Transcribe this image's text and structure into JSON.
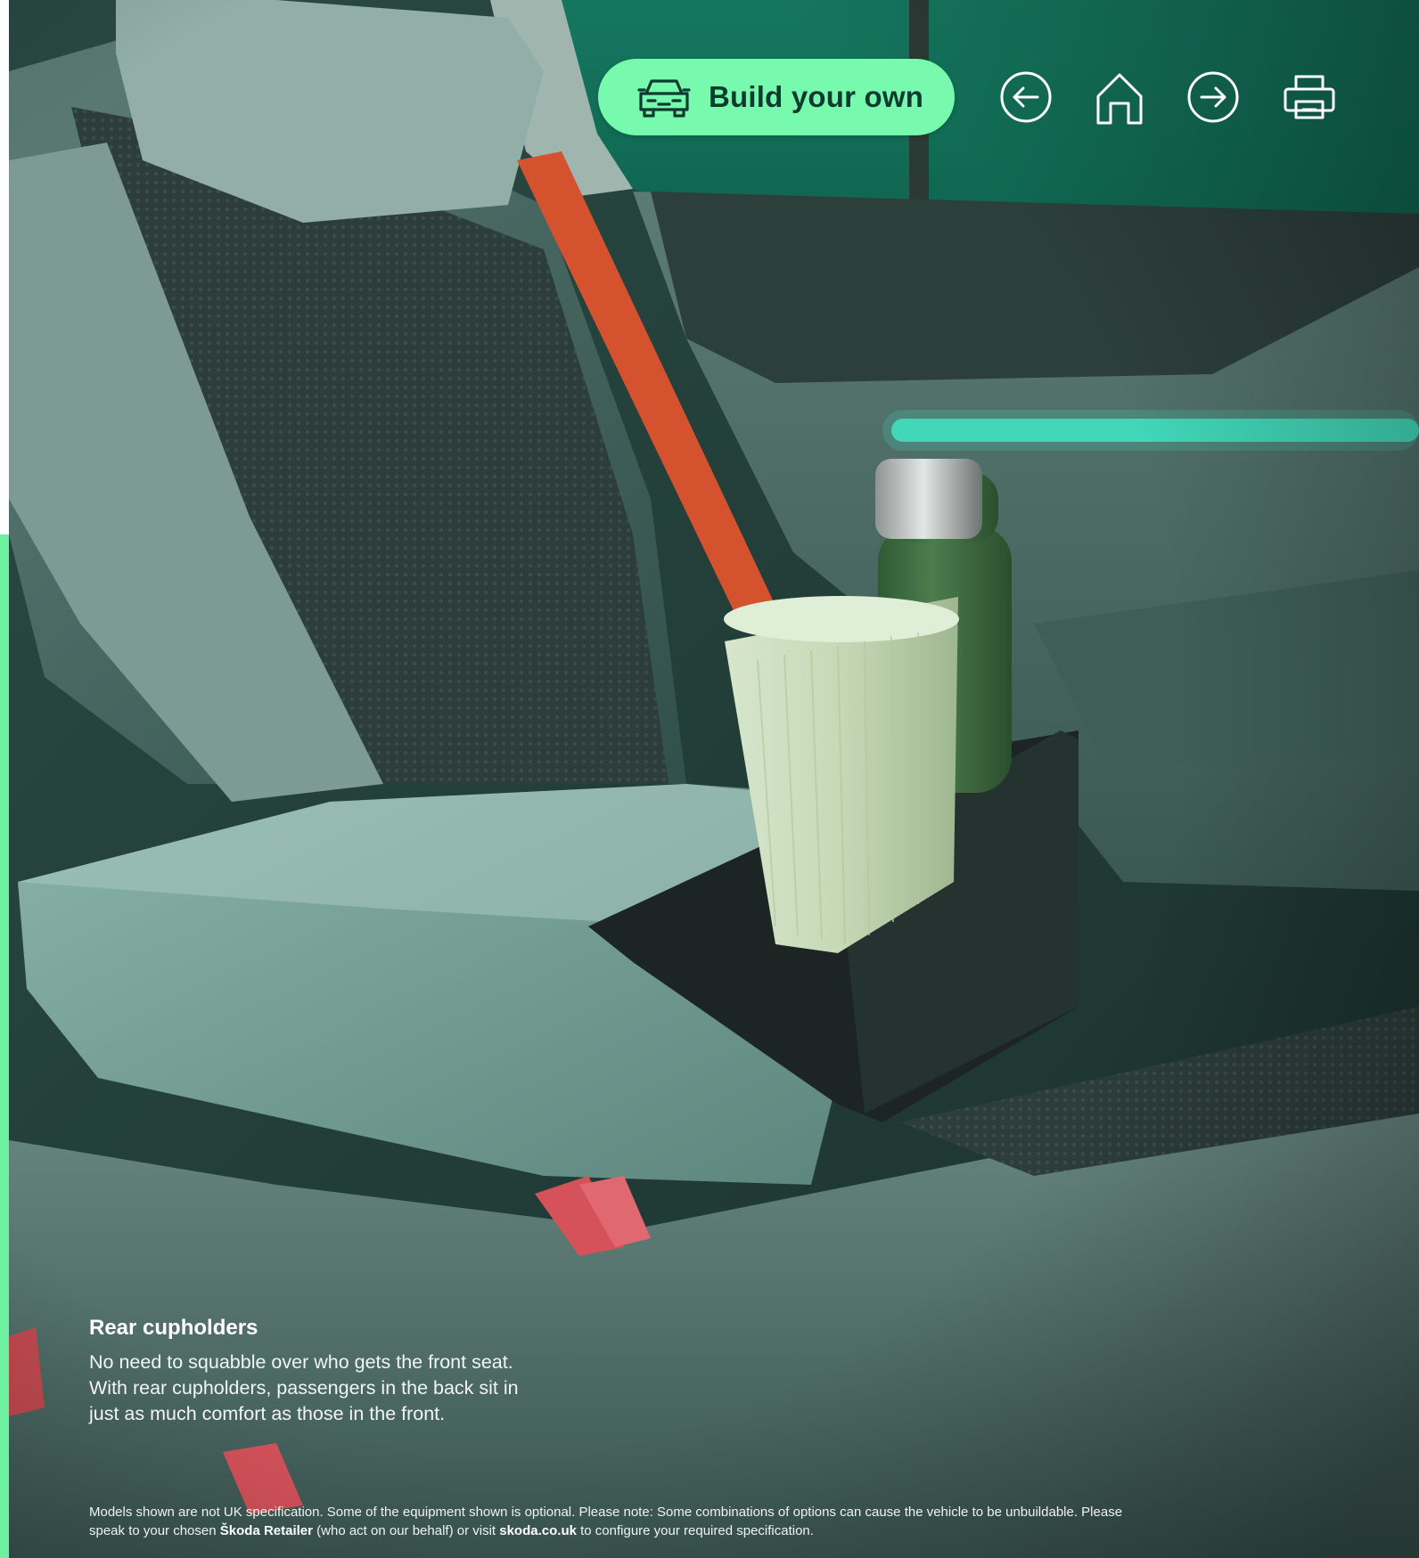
{
  "toolbar": {
    "build_label": "Build your own",
    "build_icon": "car-front-icon",
    "back_icon": "arrow-left-icon",
    "home_icon": "home-icon",
    "forward_icon": "arrow-right-icon",
    "print_icon": "printer-icon"
  },
  "feature": {
    "title": "Rear cupholders",
    "line1": "No need to squabble over who gets the front seat.",
    "line2": "With rear cupholders, passengers in the back sit in",
    "line3": "just as much comfort as those in the front."
  },
  "disclaimer": {
    "part1": "Models shown are not UK specification. Some of the equipment shown is optional. Please note: Some combinations of options can cause the vehicle to be unbuildable. Please speak to your chosen ",
    "retailer": "Škoda Retailer",
    "part2": " (who act on our behalf) or visit ",
    "website": "skoda.co.uk",
    "part3": " to configure your required specification."
  },
  "colors": {
    "accent_green": "#78faae",
    "edge_green": "#6df0a0",
    "text_dark": "#0e3a2f",
    "seatbelt": "#d5522f",
    "ambient_light": "#3fe0c0"
  }
}
